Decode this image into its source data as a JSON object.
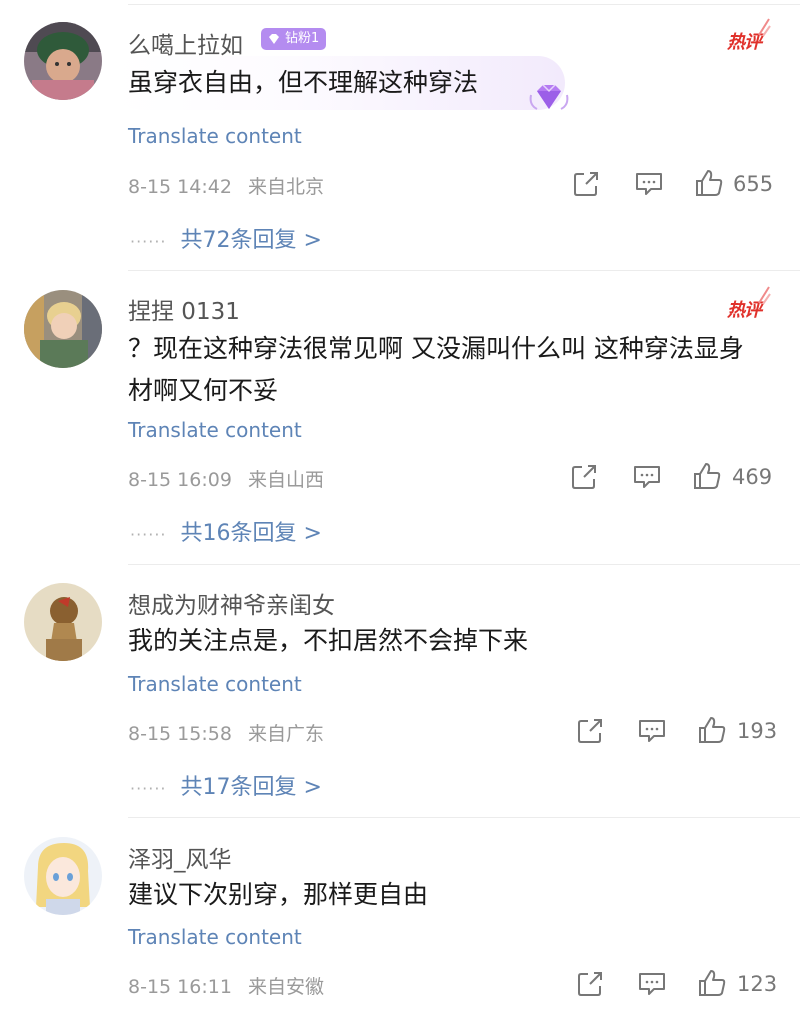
{
  "comments": [
    {
      "username": "么噶上拉如",
      "badge": "钻粉1",
      "hot_label": "热评",
      "text": "虽穿衣自由，但不理解这种穿法",
      "translate": "Translate content",
      "time": "8-15 14:42",
      "location": "来自北京",
      "likes": "655",
      "replies": "共72条回复 >"
    },
    {
      "username": "捏捏 0131",
      "hot_label": "热评",
      "text": "？现在这种穿法很常见啊 又没漏叫什么叫 这种穿法显身材啊又何不妥",
      "translate": "Translate content",
      "time": "8-15 16:09",
      "location": "来自山西",
      "likes": "469",
      "replies": "共16条回复 >"
    },
    {
      "username": "想成为财神爷亲闺女",
      "text": "我的关注点是，不扣居然不会掉下来",
      "translate": "Translate content",
      "time": "8-15 15:58",
      "location": "来自广东",
      "likes": "193",
      "replies": "共17条回复 >"
    },
    {
      "username": "泽羽_风华",
      "text": "建议下次别穿，那样更自由",
      "translate": "Translate content",
      "time": "8-15 16:11",
      "location": "来自安徽",
      "likes": "123"
    }
  ],
  "colors": {
    "link": "#5e84b6",
    "hot": "#e0312b",
    "badge": "#b48cf0"
  },
  "icons": [
    "share-icon",
    "comment-icon",
    "like-icon",
    "diamond-gem-icon"
  ]
}
